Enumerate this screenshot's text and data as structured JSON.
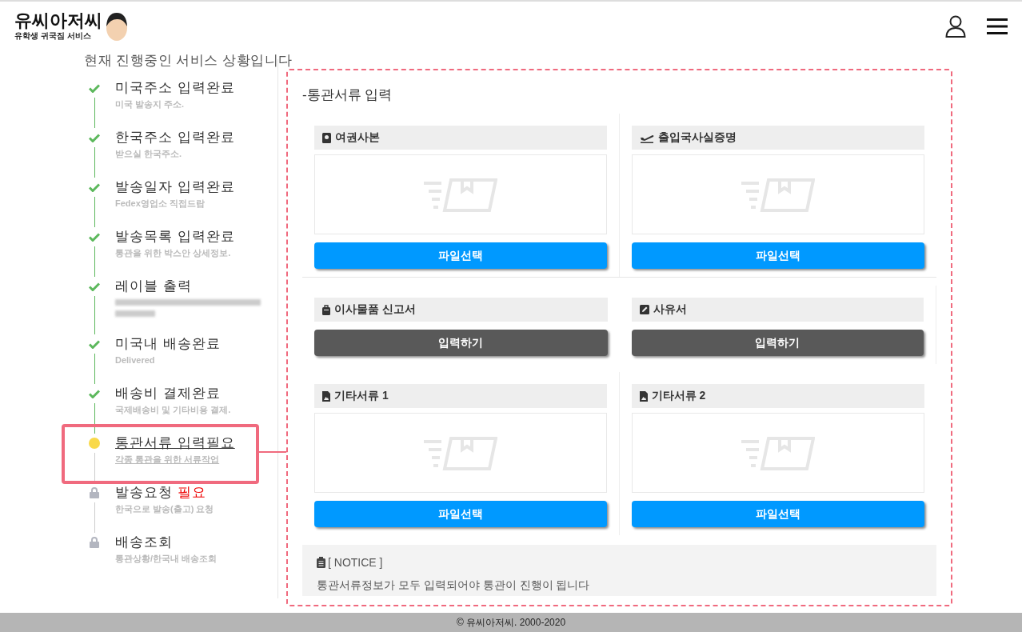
{
  "header": {
    "logo_title": "유씨아저씨",
    "logo_subtitle": "유학생 귀국짐 서비스"
  },
  "intro": "현재 진행중인 서비스 상황입니다",
  "steps": [
    {
      "kind": "done",
      "selected": false,
      "title": "미국주소 입력완료",
      "subtitle": "미국 발송지 주소."
    },
    {
      "kind": "done",
      "selected": false,
      "title": "한국주소 입력완료",
      "subtitle": "받으실 한국주소."
    },
    {
      "kind": "done",
      "selected": false,
      "title": "발송일자 입력완료",
      "subtitle": "Fedex영업소 직접드랍"
    },
    {
      "kind": "done",
      "selected": false,
      "title": "발송목록 입력완료",
      "subtitle": "통관을 위한 박스안 상세정보."
    },
    {
      "kind": "done",
      "selected": false,
      "title": "레이블 출력",
      "blurred": true
    },
    {
      "kind": "done",
      "selected": false,
      "title": "미국내 배송완료",
      "subtitle": "Delivered"
    },
    {
      "kind": "done",
      "selected": false,
      "title": "배송비 결제완료",
      "subtitle": "국제배송비 및 기타비용 결제."
    },
    {
      "kind": "current",
      "selected": true,
      "title": "통관서류 입력필요",
      "subtitle": "각종 통관을 위한 서류작업"
    },
    {
      "kind": "locked",
      "selected": false,
      "title": "발송요청",
      "badge": "필요",
      "subtitle": "한국으로 발송(출고) 요청"
    },
    {
      "kind": "locked",
      "selected": false,
      "title": "배송조회",
      "subtitle": "통관상황/한국내 배송조회"
    }
  ],
  "panel": {
    "title": "-통관서류 입력",
    "documents": [
      {
        "kind": "upload",
        "label": "여권사본",
        "button": "파일선택"
      },
      {
        "kind": "upload",
        "label": "출입국사실증명",
        "button": "파일선택"
      },
      {
        "kind": "form",
        "label": "이사물품 신고서",
        "button": "입력하기"
      },
      {
        "kind": "form",
        "label": "사유서",
        "button": "입력하기"
      },
      {
        "kind": "upload",
        "label": "기타서류 1",
        "button": "파일선택"
      },
      {
        "kind": "upload",
        "label": "기타서류 2",
        "button": "파일선택"
      }
    ],
    "notice": {
      "heading": "[ NOTICE ]",
      "text": "통관서류정보가 모두 입력되어야 통관이 진행이 됩니다"
    }
  },
  "footer": "© 유씨아저씨. 2000-2020"
}
